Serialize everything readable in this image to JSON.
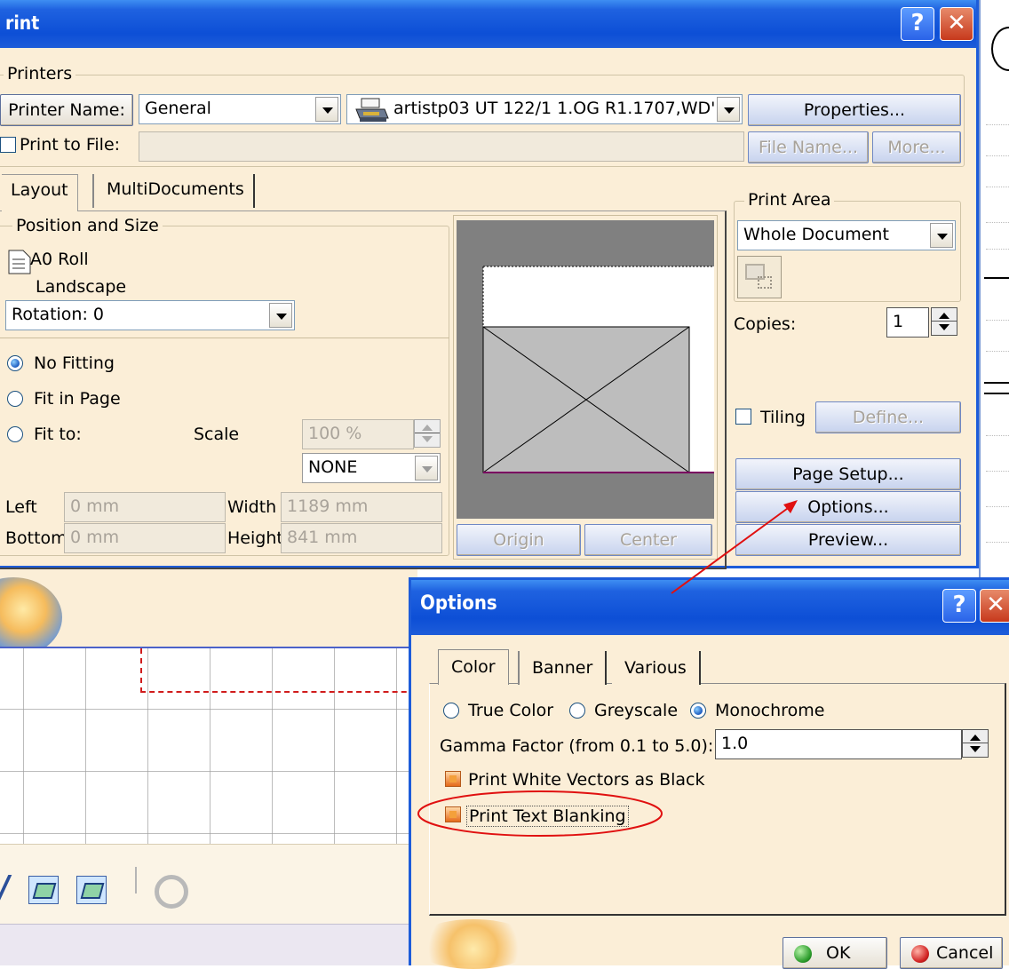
{
  "print_dialog": {
    "title": "rint",
    "help_glyph": "?",
    "close_glyph": "✕",
    "printers_group": {
      "legend": "Printers",
      "printer_name_label": "Printer Name:",
      "printer_name_value": "General",
      "device_value": "artistp03 UT 122/1 1.OG R1.1707,WD'",
      "properties_button": "Properties...",
      "print_to_file_label": "Print to File:",
      "print_to_file_checked": false,
      "file_path_value": "",
      "file_name_button": "File Name...",
      "more_button": "More..."
    },
    "tabs": [
      {
        "label": "Layout",
        "active": true
      },
      {
        "label": "MultiDocuments",
        "active": false
      }
    ],
    "position_size": {
      "legend": "Position and Size",
      "format": "A0 Roll",
      "orientation": "Landscape",
      "rotation_value": "Rotation: 0",
      "fit_options": [
        {
          "label": "No Fitting",
          "selected": true
        },
        {
          "label": "Fit in Page",
          "selected": false
        },
        {
          "label": "Fit to:",
          "selected": false
        }
      ],
      "scale_label": "Scale",
      "scale_value": "100 %",
      "scale_mode_value": "NONE",
      "left_label": "Left",
      "left_value": "0 mm",
      "bottom_label": "Bottom",
      "bottom_value": "0 mm",
      "width_label": "Width",
      "width_value": "1189 mm",
      "height_label": "Height",
      "height_value": "841 mm"
    },
    "preview": {
      "origin_button": "Origin",
      "center_button": "Center"
    },
    "print_area": {
      "legend": "Print Area",
      "value": "Whole Document"
    },
    "copies_label": "Copies:",
    "copies_value": "1",
    "tiling_label": "Tiling",
    "tiling_checked": false,
    "define_button": "Define...",
    "page_setup_button": "Page Setup...",
    "options_button": "Options...",
    "preview_button": "Preview..."
  },
  "options_dialog": {
    "title": "Options",
    "help_glyph": "?",
    "close_glyph": "✕",
    "tabs": [
      {
        "label": "Color",
        "active": true
      },
      {
        "label": "Banner",
        "active": false
      },
      {
        "label": "Various",
        "active": false
      }
    ],
    "color_modes": [
      {
        "label": "True Color",
        "selected": false
      },
      {
        "label": "Greyscale",
        "selected": false
      },
      {
        "label": "Monochrome",
        "selected": true
      }
    ],
    "gamma_label": "Gamma Factor (from 0.1 to 5.0):",
    "gamma_value": "1.0",
    "white_vectors_label": "Print White Vectors as Black",
    "white_vectors_checked": true,
    "text_blanking_label": "Print Text Blanking",
    "text_blanking_checked": true,
    "ok_button": "OK",
    "cancel_button": "Cancel"
  },
  "colors": {
    "dialog_bg": "#fbeed7",
    "titlebar": "#0d4fd6",
    "annotation_red": "#e01010",
    "preview_grey": "#808080",
    "status_green": "#2a9b2a",
    "status_red": "#d02020"
  },
  "icons": {
    "printer": "printer-icon",
    "paper": "document-icon",
    "print_area_selector": "area-select-icon",
    "ok": "green-dot-icon",
    "cancel": "red-dot-icon"
  }
}
